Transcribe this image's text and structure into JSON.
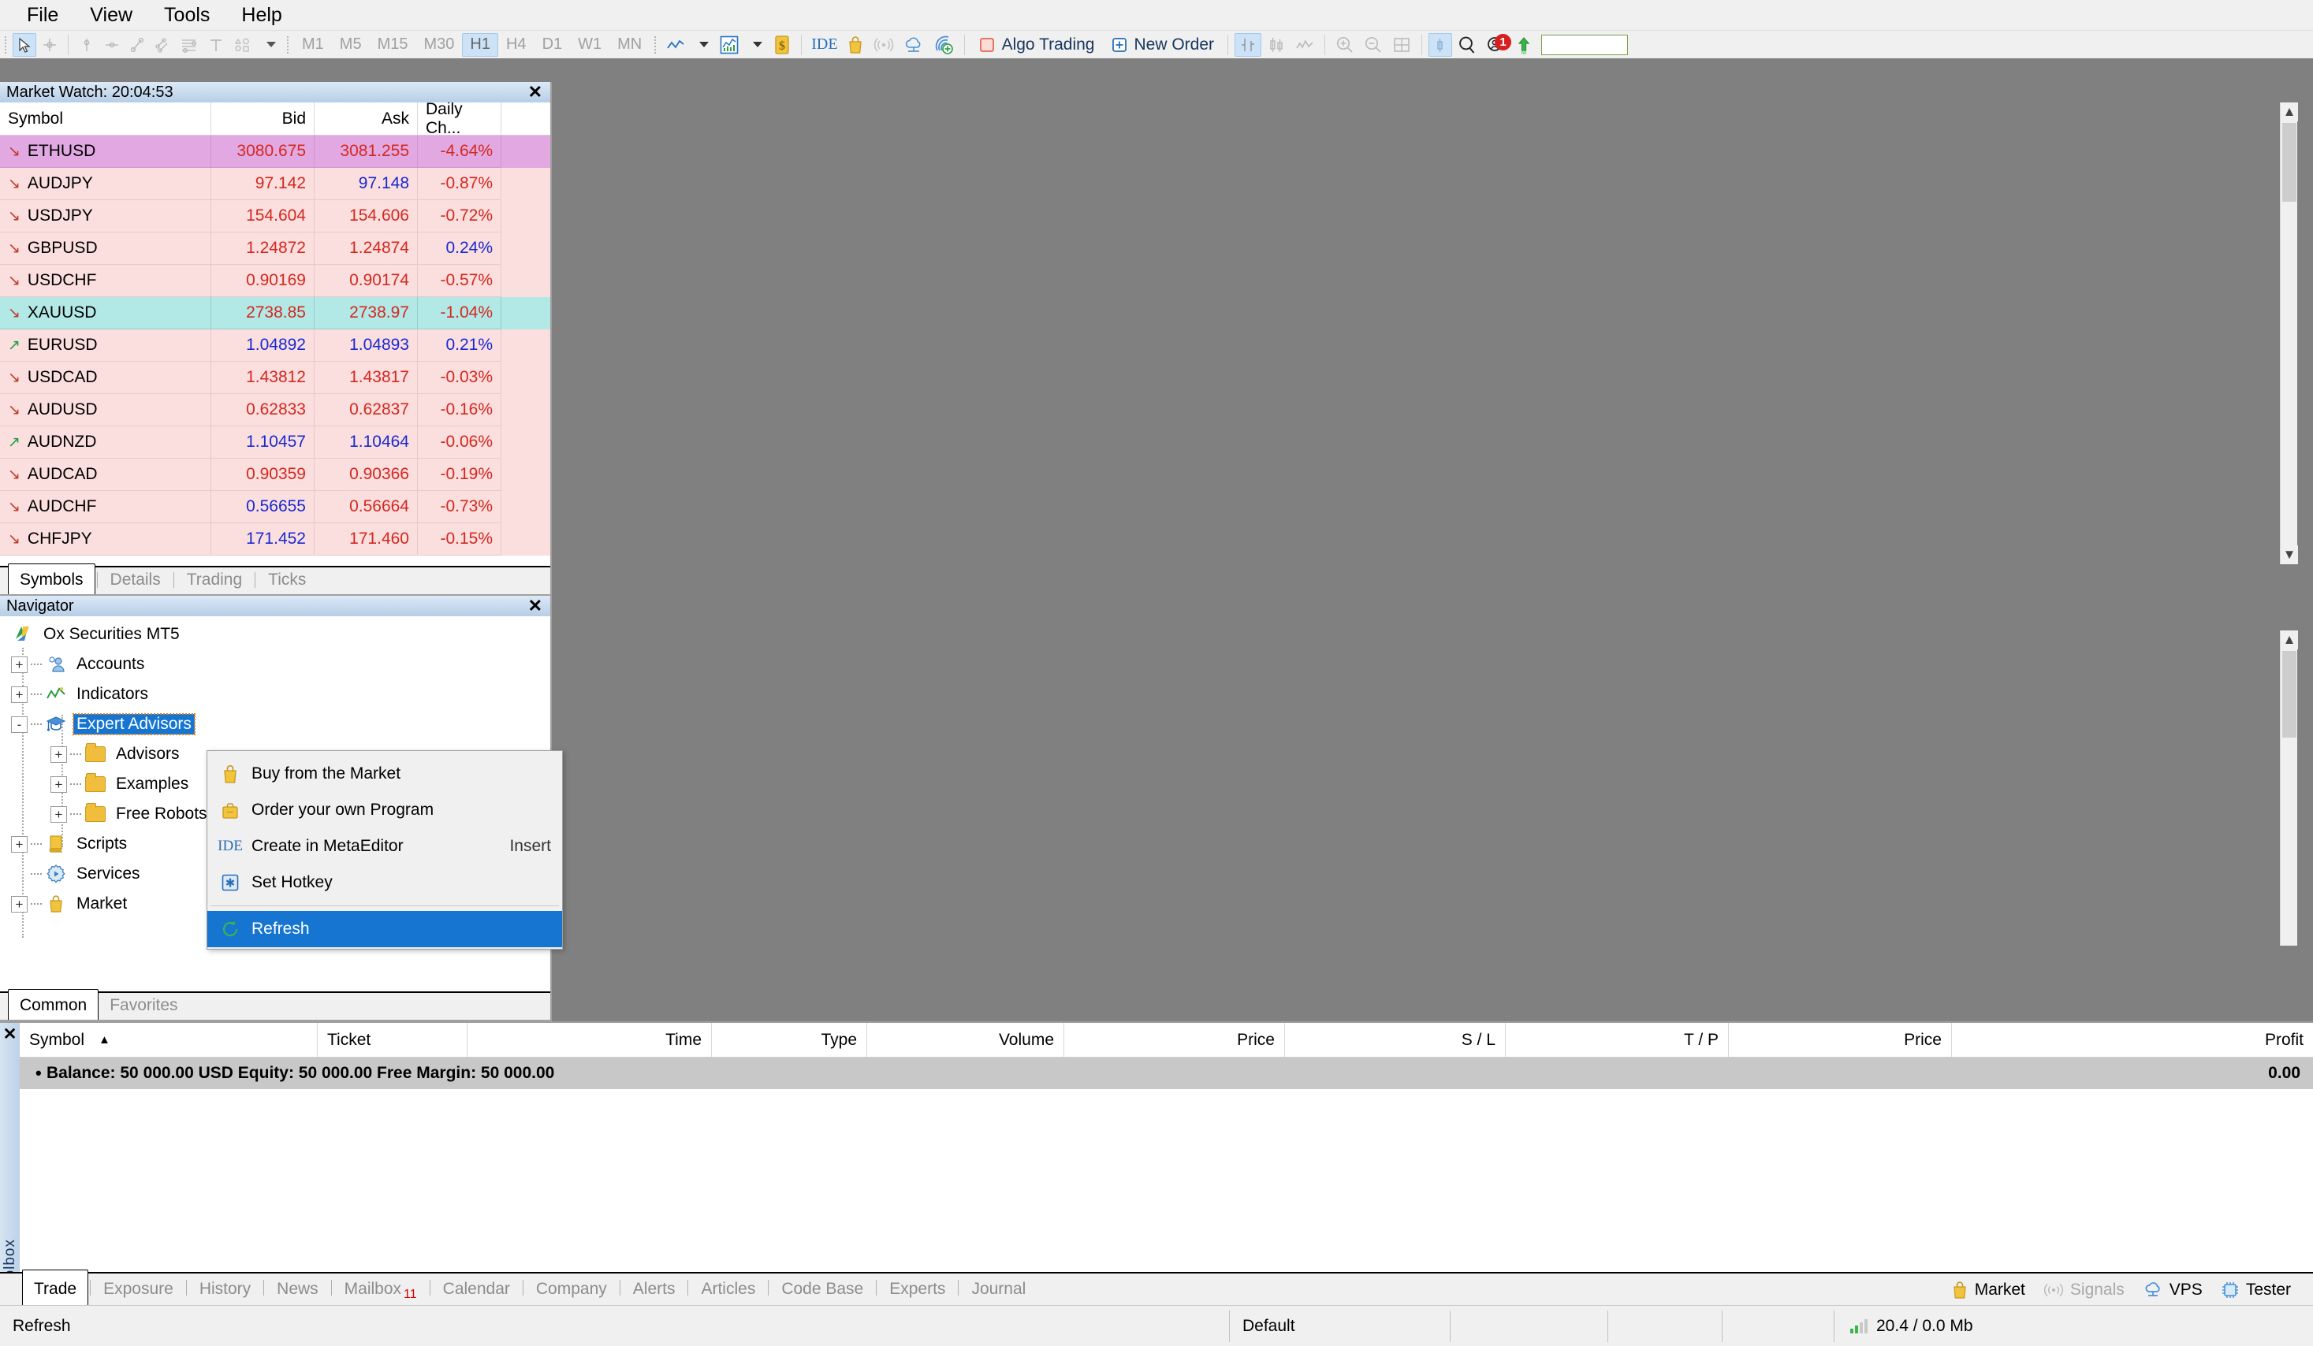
{
  "menu": {
    "items": [
      "File",
      "View",
      "Tools",
      "Help"
    ]
  },
  "toolbar": {
    "tool_icons": [
      "cursor-icon",
      "crosshair-icon",
      "vertical-line-icon",
      "horizontal-line-icon",
      "trendline-icon",
      "channel-icon",
      "fibonacci-icon",
      "text-icon",
      "shapes-icon"
    ],
    "timeframes": [
      "M1",
      "M5",
      "M15",
      "M30",
      "H1",
      "H4",
      "D1",
      "W1",
      "MN"
    ],
    "timeframe_selected": "H1",
    "ide_label": "IDE",
    "algo_trading_label": "Algo Trading",
    "new_order_label": "New Order",
    "chart_type_selected": "bar-chart-icon",
    "notification_count": "1",
    "search_value": ""
  },
  "market_watch": {
    "title": "Market Watch: 20:04:53",
    "columns": [
      "Symbol",
      "Bid",
      "Ask",
      "Daily Ch..."
    ],
    "tabs": [
      "Symbols",
      "Details",
      "Trading",
      "Ticks"
    ],
    "active_tab": "Symbols",
    "rows": [
      {
        "dir": "down",
        "symbol": "ETHUSD",
        "bid": "3080.675",
        "bid_color": "red",
        "ask": "3081.255",
        "ask_color": "red",
        "change": "-4.64%",
        "change_color": "red",
        "highlight": "purple"
      },
      {
        "dir": "down",
        "symbol": "AUDJPY",
        "bid": "97.142",
        "bid_color": "red",
        "ask": "97.148",
        "ask_color": "blue",
        "change": "-0.87%",
        "change_color": "red",
        "highlight": "none"
      },
      {
        "dir": "down",
        "symbol": "USDJPY",
        "bid": "154.604",
        "bid_color": "red",
        "ask": "154.606",
        "ask_color": "red",
        "change": "-0.72%",
        "change_color": "red",
        "highlight": "none"
      },
      {
        "dir": "down",
        "symbol": "GBPUSD",
        "bid": "1.24872",
        "bid_color": "red",
        "ask": "1.24874",
        "ask_color": "red",
        "change": "0.24%",
        "change_color": "blue",
        "highlight": "none"
      },
      {
        "dir": "down",
        "symbol": "USDCHF",
        "bid": "0.90169",
        "bid_color": "red",
        "ask": "0.90174",
        "ask_color": "red",
        "change": "-0.57%",
        "change_color": "red",
        "highlight": "none"
      },
      {
        "dir": "down",
        "symbol": "XAUUSD",
        "bid": "2738.85",
        "bid_color": "red",
        "ask": "2738.97",
        "ask_color": "red",
        "change": "-1.04%",
        "change_color": "red",
        "highlight": "cyan"
      },
      {
        "dir": "up",
        "symbol": "EURUSD",
        "bid": "1.04892",
        "bid_color": "blue",
        "ask": "1.04893",
        "ask_color": "blue",
        "change": "0.21%",
        "change_color": "blue",
        "highlight": "none"
      },
      {
        "dir": "down",
        "symbol": "USDCAD",
        "bid": "1.43812",
        "bid_color": "red",
        "ask": "1.43817",
        "ask_color": "red",
        "change": "-0.03%",
        "change_color": "red",
        "highlight": "none"
      },
      {
        "dir": "down",
        "symbol": "AUDUSD",
        "bid": "0.62833",
        "bid_color": "red",
        "ask": "0.62837",
        "ask_color": "red",
        "change": "-0.16%",
        "change_color": "red",
        "highlight": "none"
      },
      {
        "dir": "up",
        "symbol": "AUDNZD",
        "bid": "1.10457",
        "bid_color": "blue",
        "ask": "1.10464",
        "ask_color": "blue",
        "change": "-0.06%",
        "change_color": "red",
        "highlight": "none"
      },
      {
        "dir": "down",
        "symbol": "AUDCAD",
        "bid": "0.90359",
        "bid_color": "red",
        "ask": "0.90366",
        "ask_color": "red",
        "change": "-0.19%",
        "change_color": "red",
        "highlight": "none"
      },
      {
        "dir": "down",
        "symbol": "AUDCHF",
        "bid": "0.56655",
        "bid_color": "blue",
        "ask": "0.56664",
        "ask_color": "red",
        "change": "-0.73%",
        "change_color": "red",
        "highlight": "none"
      },
      {
        "dir": "down",
        "symbol": "CHFJPY",
        "bid": "171.452",
        "bid_color": "blue",
        "ask": "171.460",
        "ask_color": "red",
        "change": "-0.15%",
        "change_color": "red",
        "highlight": "none"
      }
    ]
  },
  "navigator": {
    "title": "Navigator",
    "root": "Ox Securities MT5",
    "items": [
      {
        "label": "Accounts",
        "icon": "accounts-icon",
        "expander": "+",
        "level": 1
      },
      {
        "label": "Indicators",
        "icon": "indicators-icon",
        "expander": "+",
        "level": 1
      },
      {
        "label": "Expert Advisors",
        "icon": "expert-advisors-icon",
        "expander": "-",
        "level": 1,
        "selected": true
      },
      {
        "label": "Advisors",
        "icon": "folder-icon",
        "expander": "+",
        "level": 2
      },
      {
        "label": "Examples",
        "icon": "folder-icon",
        "expander": "+",
        "level": 2
      },
      {
        "label": "Free Robots",
        "icon": "folder-icon",
        "expander": "+",
        "level": 2
      },
      {
        "label": "Scripts",
        "icon": "scripts-icon",
        "expander": "+",
        "level": 1
      },
      {
        "label": "Services",
        "icon": "services-icon",
        "expander": "",
        "level": 1
      },
      {
        "label": "Market",
        "icon": "market-bag-icon",
        "expander": "+",
        "level": 1
      }
    ],
    "tabs": [
      "Common",
      "Favorites"
    ],
    "active_tab": "Common"
  },
  "context_menu": {
    "items": [
      {
        "label": "Buy from the Market",
        "icon": "shopping-bag-icon",
        "accel": "",
        "selected": false
      },
      {
        "label": "Order your own Program",
        "icon": "briefcase-icon",
        "accel": "",
        "selected": false
      },
      {
        "label": "Create in MetaEditor",
        "icon": "ide-icon",
        "accel": "Insert",
        "selected": false
      },
      {
        "label": "Set Hotkey",
        "icon": "hotkey-icon",
        "accel": "",
        "selected": false
      },
      {
        "label": "Refresh",
        "icon": "refresh-icon",
        "accel": "",
        "selected": true,
        "separator_before": true
      }
    ]
  },
  "toolbox": {
    "side_label": "Toolbox",
    "columns": [
      "Symbol",
      "Ticket",
      "Time",
      "Type",
      "Volume",
      "Price",
      "S / L",
      "T / P",
      "Price",
      "Profit"
    ],
    "sort_column": "Symbol",
    "sort_indicator": "▲",
    "balance_line": "Balance: 50 000.00 USD  Equity: 50 000.00  Free Margin: 50 000.00",
    "balance_profit": "0.00",
    "tabs": [
      {
        "label": "Trade",
        "active": true
      },
      {
        "label": "Exposure",
        "active": false
      },
      {
        "label": "History",
        "active": false
      },
      {
        "label": "News",
        "active": false
      },
      {
        "label": "Mailbox",
        "active": false,
        "badge": "11"
      },
      {
        "label": "Calendar",
        "active": false
      },
      {
        "label": "Company",
        "active": false
      },
      {
        "label": "Alerts",
        "active": false
      },
      {
        "label": "Articles",
        "active": false
      },
      {
        "label": "Code Base",
        "active": false
      },
      {
        "label": "Experts",
        "active": false
      },
      {
        "label": "Journal",
        "active": false
      }
    ],
    "right_items": [
      {
        "label": "Market",
        "icon": "market-bag-icon",
        "dim": false
      },
      {
        "label": "Signals",
        "icon": "signals-icon",
        "dim": true
      },
      {
        "label": "VPS",
        "icon": "vps-cloud-icon",
        "dim": false
      },
      {
        "label": "Tester",
        "icon": "tester-chip-icon",
        "dim": false
      }
    ]
  },
  "statusbar": {
    "message": "Refresh",
    "profile": "Default",
    "network": "20.4 / 0.0 Mb"
  },
  "colors": {
    "accent_blue": "#1675d1",
    "highlight_purple": "#e2a8e2",
    "highlight_cyan": "#b2e8e6",
    "row_pink": "#fbdede",
    "price_red": "#d4281e",
    "price_blue": "#1a29cf",
    "badge_red": "#d00000",
    "chart_bg": "#808080"
  }
}
